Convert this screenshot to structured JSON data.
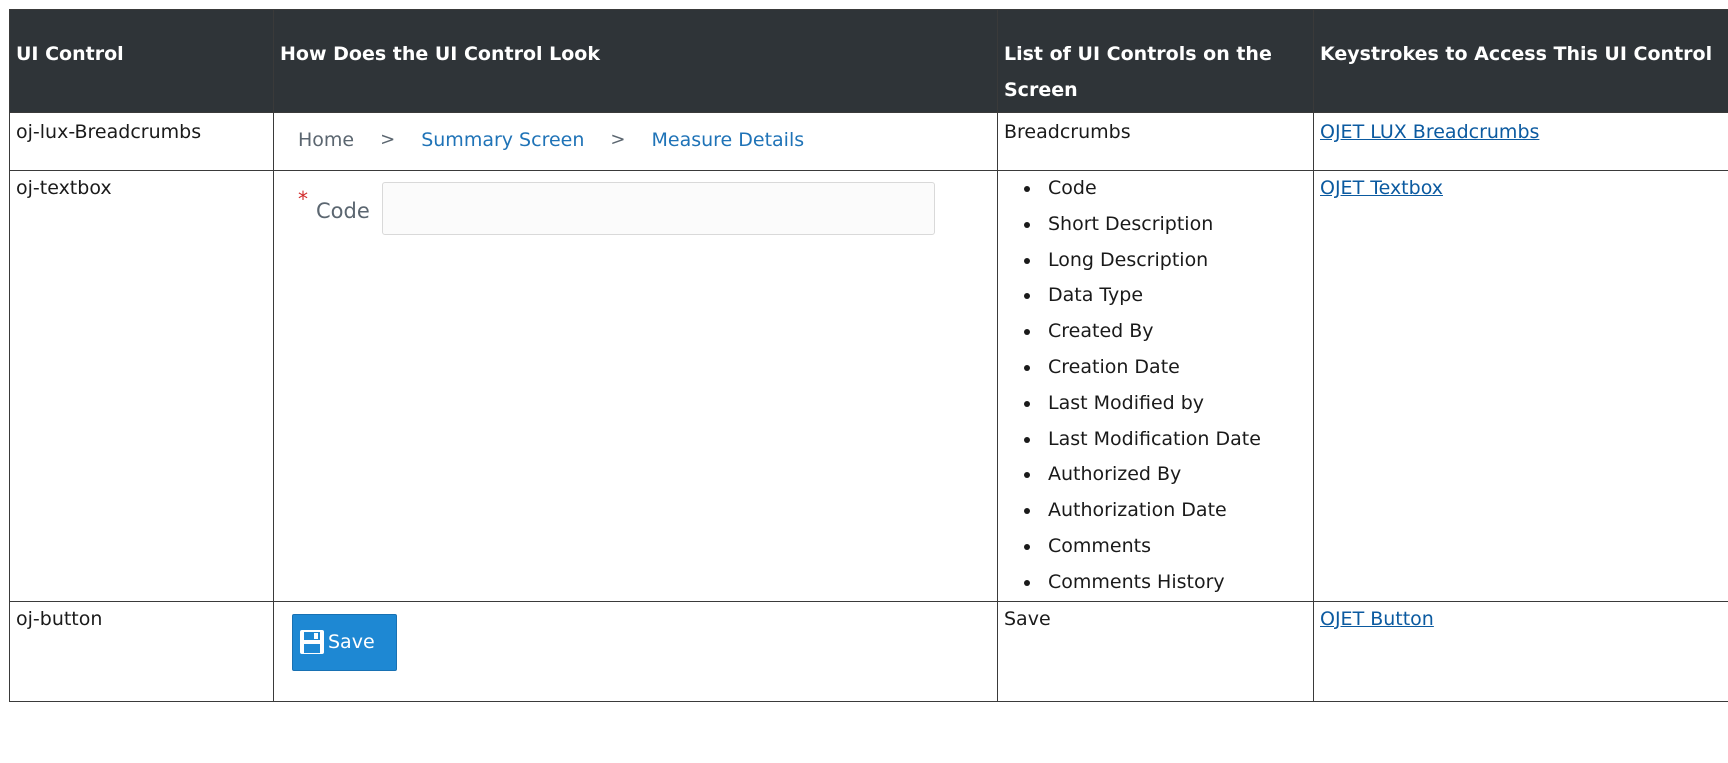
{
  "table": {
    "headers": [
      "UI Control",
      "How Does the UI Control Look",
      "List of UI Controls on the Screen",
      "Keystrokes to Access This UI Control"
    ],
    "rows": [
      {
        "control": "oj-lux-Breadcrumbs",
        "visual": {
          "items": [
            "Home",
            "Summary Screen",
            "Measure Details"
          ],
          "separator": ">"
        },
        "list_text": "Breadcrumbs",
        "link": "OJET LUX Breadcrumbs"
      },
      {
        "control": "oj-textbox",
        "visual": {
          "required_marker": "*",
          "label": "Code",
          "value": ""
        },
        "list_items": [
          "Code",
          "Short Description",
          "Long Description",
          "Data Type",
          "Created By",
          "Creation Date",
          "Last Modified by",
          "Last Modification Date",
          "Authorized By",
          "Authorization Date",
          "Comments",
          "Comments History"
        ],
        "link": "OJET Textbox"
      },
      {
        "control": "oj-button",
        "visual": {
          "label": "Save",
          "icon": "save-icon"
        },
        "list_text": "Save",
        "link": "OJET Button"
      }
    ]
  },
  "colors": {
    "header_bg": "#2f3438",
    "link": "#0b5aa0",
    "breadcrumb_link": "#1f73b7",
    "button_bg": "#1e88d3",
    "required": "#d12b2b"
  }
}
